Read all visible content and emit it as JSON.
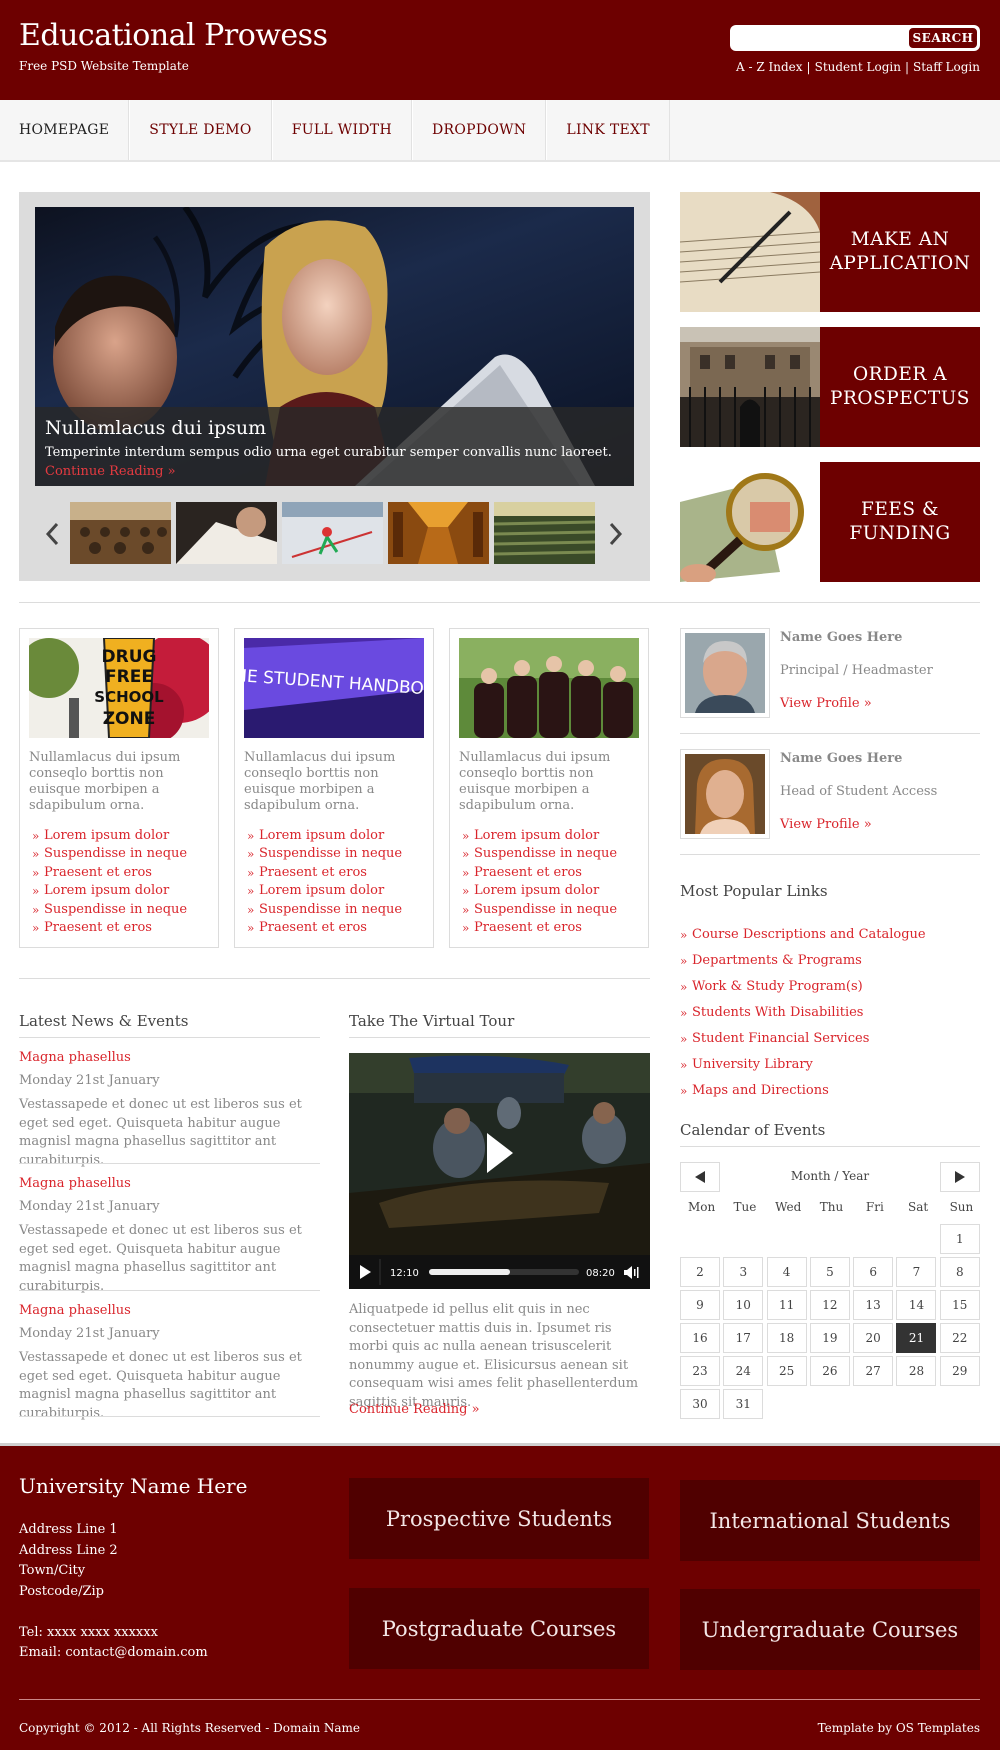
{
  "header": {
    "title": "Educational Prowess",
    "tagline": "Free PSD Website Template",
    "search": {
      "placeholder": "",
      "button": "SEARCH"
    },
    "top_links": [
      "A - Z Index",
      "Student Login",
      "Staff Login"
    ]
  },
  "nav": [
    "HOMEPAGE",
    "STYLE DEMO",
    "FULL WIDTH",
    "DROPDOWN",
    "LINK TEXT"
  ],
  "slider": {
    "heading": "Nullamlacus dui ipsum",
    "text": "Temperinte interdum sempus odio urna eget curabitur semper convallis nunc laoreet.",
    "link": "Continue Reading »"
  },
  "side_boxes": [
    {
      "line1": "MAKE AN",
      "line2": "APPLICATION"
    },
    {
      "line1": "ORDER A",
      "line2": "PROSPECTUS"
    },
    {
      "line1": "FEES &",
      "line2": "FUNDING"
    }
  ],
  "features": [
    {
      "desc": "Nullamlacus dui ipsum conseqlo borttis non euisque morbipen a sdapibulum orna.",
      "items": [
        "Lorem ipsum dolor",
        "Suspendisse in neque",
        "Praesent et eros",
        "Lorem ipsum dolor",
        "Suspendisse in neque",
        "Praesent et eros"
      ]
    },
    {
      "desc": "Nullamlacus dui ipsum conseqlo borttis non euisque morbipen a sdapibulum orna.",
      "items": [
        "Lorem ipsum dolor",
        "Suspendisse in neque",
        "Praesent et eros",
        "Lorem ipsum dolor",
        "Suspendisse in neque",
        "Praesent et eros"
      ]
    },
    {
      "desc": "Nullamlacus dui ipsum conseqlo borttis non euisque morbipen a sdapibulum orna.",
      "items": [
        "Lorem ipsum dolor",
        "Suspendisse in neque",
        "Praesent et eros",
        "Lorem ipsum dolor",
        "Suspendisse in neque",
        "Praesent et eros"
      ]
    }
  ],
  "feature_images": {
    "sign_text": "DRUG FREE SCHOOL ZONE",
    "handbook_text": "THE STUDENT HANDBOOK"
  },
  "staff": [
    {
      "name": "Name Goes Here",
      "role": "Principal / Headmaster",
      "link": "View Profile »"
    },
    {
      "name": "Name Goes Here",
      "role": "Head of Student Access",
      "link": "View Profile »"
    }
  ],
  "popular": {
    "title": "Most Popular Links",
    "links": [
      "Course Descriptions and Catalogue",
      "Departments & Programs",
      "Work & Study Program(s)",
      "Students With Disabilities",
      "Student Financial Services",
      "University Library",
      "Maps and Directions"
    ]
  },
  "calendar": {
    "title": "Calendar of Events",
    "month": "Month / Year",
    "days": [
      "Mon",
      "Tue",
      "Wed",
      "Thu",
      "Fri",
      "Sat",
      "Sun"
    ],
    "dates": [
      "",
      "",
      "",
      "",
      "",
      "",
      "1",
      "2",
      "3",
      "4",
      "5",
      "6",
      "7",
      "8",
      "9",
      "10",
      "11",
      "12",
      "13",
      "14",
      "15",
      "16",
      "17",
      "18",
      "19",
      "20",
      "21",
      "22",
      "23",
      "24",
      "25",
      "26",
      "27",
      "28",
      "29",
      "30",
      "31"
    ],
    "today": "21"
  },
  "news": {
    "title": "Latest News & Events",
    "items": [
      {
        "title": "Magna phasellus",
        "date": "Monday 21st January",
        "body": "Vestassapede et donec ut est liberos sus et eget sed eget. Quisqueta habitur augue magnisl magna phasellus sagittitor ant curabiturpis."
      },
      {
        "title": "Magna phasellus",
        "date": "Monday 21st January",
        "body": "Vestassapede et donec ut est liberos sus et eget sed eget. Quisqueta habitur augue magnisl magna phasellus sagittitor ant curabiturpis."
      },
      {
        "title": "Magna phasellus",
        "date": "Monday 21st January",
        "body": "Vestassapede et donec ut est liberos sus et eget sed eget. Quisqueta habitur augue magnisl magna phasellus sagittitor ant curabiturpis."
      }
    ]
  },
  "tour": {
    "title": "Take The Virtual Tour",
    "elapsed": "12:10",
    "duration": "08:20",
    "progress": 0.54,
    "text": "Aliquatpede id pellus elit quis in nec consectetuer mattis duis in. Ipsumet ris morbi quis ac nulla aenean trisuscelerit nonummy augue et. Elisicursus aenean sit consequam wisi ames felit phasellenterdum sagittis sit mauris.",
    "link": "Continue Reading »"
  },
  "footer": {
    "university": "University Name Here",
    "address": [
      "Address Line 1",
      "Address Line 2",
      "Town/City",
      "Postcode/Zip"
    ],
    "tel": "Tel: xxxx xxxx xxxxxx",
    "email": "Email: contact@domain.com",
    "boxes": [
      "Prospective Students",
      "International Students",
      "Postgraduate Courses",
      "Undergraduate Courses"
    ],
    "copyright": "Copyright © 2012 - All Rights Reserved - Domain Name",
    "credit": "Template by OS Templates"
  },
  "colors": {
    "brand": "#6d0000",
    "accent": "#d9242b",
    "footer_box": "#500000"
  }
}
